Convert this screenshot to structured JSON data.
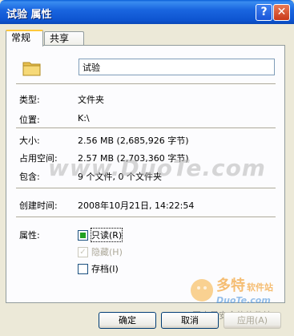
{
  "window": {
    "title": "试验 属性",
    "help_label": "?",
    "close_label": "✕"
  },
  "tabs": [
    {
      "label": "常规"
    },
    {
      "label": "共享"
    }
  ],
  "general": {
    "name_value": "试验",
    "fields": {
      "type_label": "类型:",
      "type_value": "文件夹",
      "location_label": "位置:",
      "location_value": "K:\\",
      "size_label": "大小:",
      "size_value": "2.56 MB (2,685,926 字节)",
      "disk_size_label": "占用空间:",
      "disk_size_value": "2.57 MB (2,703,360 字节)",
      "contains_label": "包含:",
      "contains_value": "9 个文件, 0 个文件夹",
      "created_label": "创建时间:",
      "created_value": "2008年10月21日, 14:22:54",
      "attributes_label": "属性:"
    },
    "attributes": {
      "readonly_label": "只读(R)",
      "hidden_label": "隐藏(H)",
      "archive_label": "存档(I)"
    }
  },
  "buttons": {
    "ok": "确定",
    "cancel": "取消",
    "apply": "应用(A)"
  },
  "watermark": {
    "text": "www.DuoTe.com",
    "logo_title": "多特软件站",
    "logo_url": "DuoTe.com",
    "logo_slogan": "国内最安全的软件站"
  }
}
